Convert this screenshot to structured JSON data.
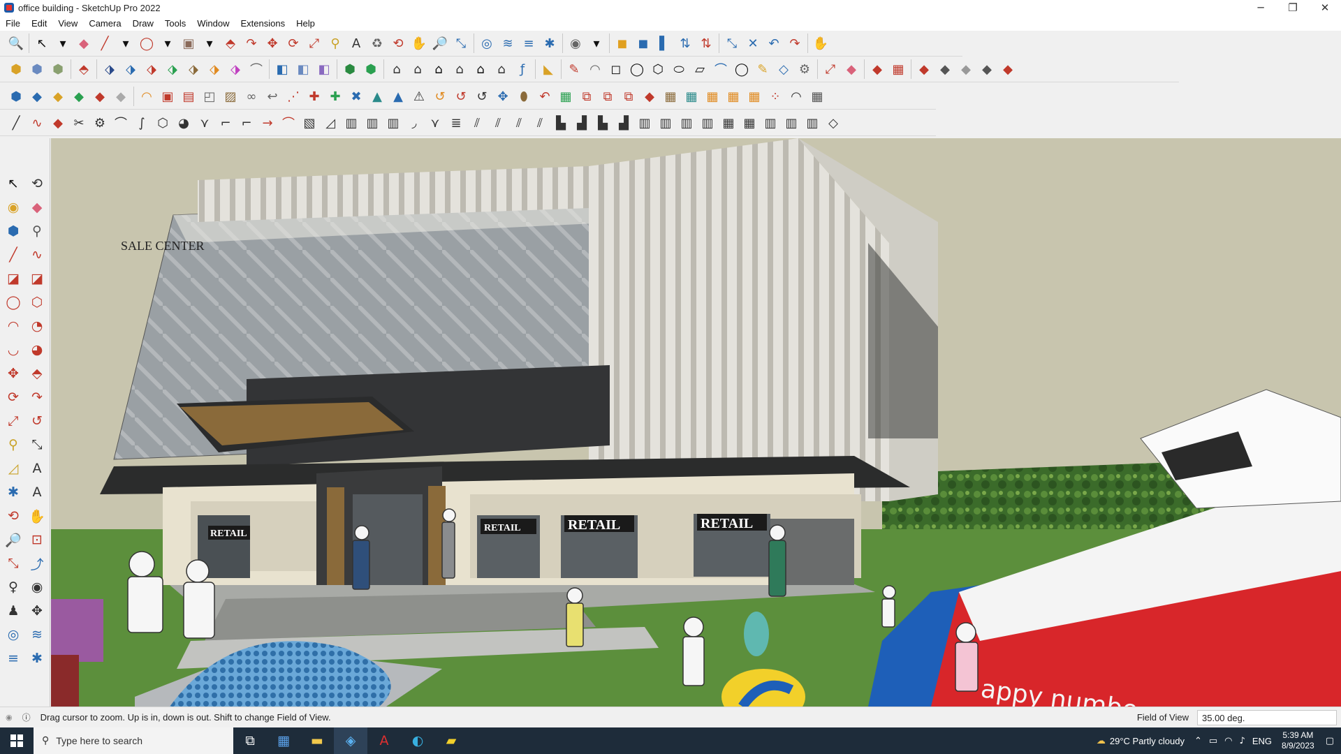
{
  "window": {
    "title": "office building - SketchUp Pro 2022",
    "minimize": "─",
    "maximize": "❐",
    "close": "✕"
  },
  "menu": [
    "File",
    "Edit",
    "View",
    "Camera",
    "Draw",
    "Tools",
    "Window",
    "Extensions",
    "Help"
  ],
  "toolbars": [
    {
      "icons": [
        [
          "zoom-icon",
          "🔍",
          "#222"
        ],
        [
          "sep"
        ],
        [
          "select-icon",
          "↖",
          "#111"
        ],
        [
          "dropdown-arrow-icon",
          "▾",
          "#111"
        ],
        [
          "eraser-icon",
          "◆",
          "#d9627a"
        ],
        [
          "pencil-icon",
          "╱",
          "#c0392b"
        ],
        [
          "dropdown-arrow-icon",
          "▾",
          "#111"
        ],
        [
          "lasso-icon",
          "◯",
          "#c0392b"
        ],
        [
          "dropdown-arrow-icon",
          "▾",
          "#111"
        ],
        [
          "paint-bucket-icon",
          "▣",
          "#8a6a5a"
        ],
        [
          "dropdown-arrow-icon",
          "▾",
          "#111"
        ],
        [
          "push-pull-icon",
          "⬘",
          "#c0392b"
        ],
        [
          "follow-me-icon",
          "↷",
          "#c0392b"
        ],
        [
          "move-icon",
          "✥",
          "#c0392b"
        ],
        [
          "rotate-icon",
          "⟳",
          "#c0392b"
        ],
        [
          "scale-icon",
          "⤢",
          "#c0392b"
        ],
        [
          "tape-measure-icon",
          "⚲",
          "#c9a227"
        ],
        [
          "text-icon",
          "A",
          "#333"
        ],
        [
          "paint-icon",
          "♻",
          "#666"
        ],
        [
          "orbit-icon",
          "⟲",
          "#c0392b"
        ],
        [
          "pan-icon",
          "✋",
          "#d49a3a"
        ],
        [
          "zoom-tool-icon",
          "🔎",
          "#2a6bb0"
        ],
        [
          "zoom-extents-icon",
          "⤡",
          "#2a6bb0"
        ],
        [
          "sep"
        ],
        [
          "warehouse-icon",
          "◎",
          "#2a6bb0"
        ],
        [
          "extension-warehouse-icon",
          "≋",
          "#2a6bb0"
        ],
        [
          "layers-icon",
          "≡",
          "#2a6bb0"
        ],
        [
          "styles-icon",
          "✱",
          "#2a6bb0"
        ],
        [
          "sep"
        ],
        [
          "account-icon",
          "◉",
          "#666"
        ],
        [
          "dropdown-arrow-icon",
          "▾",
          "#111"
        ],
        [
          "sep"
        ],
        [
          "section-plane-icon",
          "◼",
          "#e0a020"
        ],
        [
          "section-display-icon",
          "◼",
          "#2a6bb0"
        ],
        [
          "section-cut-icon",
          "▌",
          "#2a6bb0"
        ],
        [
          "arrange-icon",
          "⇅",
          "#2a6bb0"
        ],
        [
          "flip-icon",
          "⇅",
          "#c0392b"
        ],
        [
          "sep"
        ],
        [
          "dimension-icon",
          "⤡",
          "#2a6bb0"
        ],
        [
          "protractor-icon",
          "✕",
          "#2a6bb0"
        ],
        [
          "undo-icon",
          "↶",
          "#2a6bb0"
        ],
        [
          "redo-icon",
          "↷",
          "#c0392b"
        ],
        [
          "sep"
        ],
        [
          "hand-icon",
          "✋",
          "#c0392b"
        ]
      ]
    },
    {
      "icons": [
        [
          "box-xray-icon",
          "⬢",
          "#d9a227"
        ],
        [
          "box-wire-icon",
          "⬢",
          "#6a8ac0"
        ],
        [
          "box-shaded-icon",
          "⬢",
          "#8aa070"
        ],
        [
          "sep"
        ],
        [
          "push-pull-icon",
          "⬘",
          "#c0392b"
        ],
        [
          "sep"
        ],
        [
          "extrude-icon",
          "⬗",
          "#2a4a8a"
        ],
        [
          "extrude-icon",
          "⬗",
          "#2a6bb0"
        ],
        [
          "extrude-icon",
          "⬗",
          "#c0392b"
        ],
        [
          "extrude-icon",
          "⬗",
          "#2aa050"
        ],
        [
          "extrude-icon",
          "⬗",
          "#8a6a3a"
        ],
        [
          "extrude-icon",
          "⬗",
          "#e08a20"
        ],
        [
          "extrude-icon",
          "⬗",
          "#c040c0"
        ],
        [
          "curve-icon",
          "⌒",
          "#666"
        ],
        [
          "sep"
        ],
        [
          "shape-icon",
          "◧",
          "#2a6bb0"
        ],
        [
          "shape-icon",
          "◧",
          "#6a8ac0"
        ],
        [
          "shape-icon",
          "◧",
          "#8a6ac0"
        ],
        [
          "sep"
        ],
        [
          "component-icon",
          "⬢",
          "#2a8a40"
        ],
        [
          "component-icon",
          "⬢",
          "#2aa050"
        ],
        [
          "sep"
        ],
        [
          "house-icon",
          "⌂",
          "#333"
        ],
        [
          "house-icon",
          "⌂",
          "#333"
        ],
        [
          "house-icon",
          "⌂",
          "#111"
        ],
        [
          "house-icon",
          "⌂",
          "#333"
        ],
        [
          "house-icon",
          "⌂",
          "#111"
        ],
        [
          "house-icon",
          "⌂",
          "#333"
        ],
        [
          "function-icon",
          "ƒ",
          "#2a6bb0"
        ],
        [
          "sep"
        ],
        [
          "tag-icon",
          "◣",
          "#d9a227"
        ],
        [
          "sep"
        ],
        [
          "edit-icon",
          "✎",
          "#c0392b"
        ],
        [
          "arc-icon",
          "◠",
          "#666"
        ],
        [
          "square-icon",
          "◻",
          "#111"
        ],
        [
          "circle-icon",
          "◯",
          "#111"
        ],
        [
          "polygon-icon",
          "⬡",
          "#111"
        ],
        [
          "ellipse-icon",
          "⬭",
          "#111"
        ],
        [
          "parallelogram-icon",
          "▱",
          "#111"
        ],
        [
          "curve-icon",
          "⌒",
          "#2a6bb0"
        ],
        [
          "circle-icon",
          "◯",
          "#111"
        ],
        [
          "edit-icon",
          "✎",
          "#d9a227"
        ],
        [
          "stamp-icon",
          "◇",
          "#2a6bb0"
        ],
        [
          "gear-icon",
          "⚙",
          "#666"
        ],
        [
          "sep"
        ],
        [
          "line-tool-icon",
          "⤢",
          "#c0392b"
        ],
        [
          "eraser-icon",
          "◆",
          "#d9627a"
        ],
        [
          "sep"
        ],
        [
          "stamp-icon",
          "◆",
          "#c0392b"
        ],
        [
          "grid-icon",
          "▦",
          "#c0392b"
        ],
        [
          "sep"
        ],
        [
          "sandbox-icon",
          "◆",
          "#c0392b"
        ],
        [
          "sandbox-icon",
          "◆",
          "#555"
        ],
        [
          "sandbox-icon",
          "◆",
          "#999"
        ],
        [
          "sandbox-icon",
          "◆",
          "#555"
        ],
        [
          "sandbox-icon",
          "◆",
          "#c0392b"
        ]
      ]
    },
    {
      "icons": [
        [
          "cube-icon",
          "⬢",
          "#2a6bb0"
        ],
        [
          "plane-icon",
          "◆",
          "#2a6bb0"
        ],
        [
          "plane-icon",
          "◆",
          "#d9a227"
        ],
        [
          "plane-icon",
          "◆",
          "#2aa050"
        ],
        [
          "plane-icon",
          "◆",
          "#c0392b"
        ],
        [
          "plane-icon",
          "◆",
          "#aaa"
        ],
        [
          "sep"
        ],
        [
          "arc-icon",
          "◠",
          "#e08a20"
        ],
        [
          "rect-icon",
          "▣",
          "#c0392b"
        ],
        [
          "table-icon",
          "▤",
          "#c0392b"
        ],
        [
          "frame-icon",
          "◰",
          "#666"
        ],
        [
          "box-icon",
          "▨",
          "#8a6a3a"
        ],
        [
          "link-icon",
          "∞",
          "#666"
        ],
        [
          "bend-icon",
          "↩",
          "#666"
        ],
        [
          "dotted-icon",
          "⋰",
          "#c0392b"
        ],
        [
          "cross-icon",
          "✚",
          "#c0392b"
        ],
        [
          "cross-icon",
          "✚",
          "#2aa050"
        ],
        [
          "scissors-icon",
          "✖",
          "#2a6bb0"
        ],
        [
          "cone-icon",
          "▲",
          "#2a8a8a"
        ],
        [
          "cone-icon",
          "▲",
          "#2a6bb0"
        ],
        [
          "warning-icon",
          "⚠",
          "#333"
        ],
        [
          "spiral-icon",
          "↺",
          "#e08a20"
        ],
        [
          "spiral-icon",
          "↺",
          "#c0392b"
        ],
        [
          "spiral-icon",
          "↺",
          "#333"
        ],
        [
          "move-icon",
          "✥",
          "#2a6bb0"
        ],
        [
          "cylinder-icon",
          "⬮",
          "#8a6a3a"
        ],
        [
          "loop-icon",
          "↶",
          "#c0392b"
        ],
        [
          "grid-icon",
          "▦",
          "#2aa050"
        ],
        [
          "array-icon",
          "⧉",
          "#c0392b"
        ],
        [
          "array-icon",
          "⧉",
          "#c0392b"
        ],
        [
          "array-icon",
          "⧉",
          "#c0392b"
        ],
        [
          "label-icon",
          "◆",
          "#c0392b"
        ],
        [
          "grid-icon",
          "▦",
          "#8a6a3a"
        ],
        [
          "grid-icon",
          "▦",
          "#2a8a8a"
        ],
        [
          "grid-icon",
          "▦",
          "#e08a20"
        ],
        [
          "grid-icon",
          "▦",
          "#e08a20"
        ],
        [
          "grid-icon",
          "▦",
          "#e08a20"
        ],
        [
          "scatter-icon",
          "⁘",
          "#c0392b"
        ],
        [
          "arc-icon",
          "◠",
          "#333"
        ],
        [
          "grid-icon",
          "▦",
          "#555"
        ]
      ]
    },
    {
      "icons": [
        [
          "line-icon",
          "╱",
          "#333"
        ],
        [
          "bezier-icon",
          "∿",
          "#c0392b"
        ],
        [
          "car-icon",
          "◆",
          "#c0392b"
        ],
        [
          "scissors-icon",
          "✂",
          "#333"
        ],
        [
          "gear-icon",
          "⚙",
          "#333"
        ],
        [
          "link-icon",
          "⌒",
          "#333"
        ],
        [
          "pipe-icon",
          "∫",
          "#333"
        ],
        [
          "cube-outline-icon",
          "⬡",
          "#333"
        ],
        [
          "sphere-icon",
          "◕",
          "#333"
        ],
        [
          "fold-icon",
          "⋎",
          "#333"
        ],
        [
          "path-icon",
          "⌐",
          "#333"
        ],
        [
          "path-icon",
          "⌐",
          "#333"
        ],
        [
          "arrow-line-icon",
          "→",
          "#c0392b"
        ],
        [
          "curve-icon",
          "⌒",
          "#c0392b"
        ],
        [
          "box-icon",
          "▧",
          "#333"
        ],
        [
          "wedge-icon",
          "◿",
          "#333"
        ],
        [
          "bars-icon",
          "▥",
          "#333"
        ],
        [
          "bars-icon",
          "▥",
          "#333"
        ],
        [
          "bars-icon",
          "▥",
          "#333"
        ],
        [
          "curtain-icon",
          "◞",
          "#333"
        ],
        [
          "fold-icon",
          "⋎",
          "#333"
        ],
        [
          "stack-icon",
          "≣",
          "#333"
        ],
        [
          "slash-icon",
          "⫽",
          "#333"
        ],
        [
          "slash-icon",
          "⫽",
          "#333"
        ],
        [
          "slash-icon",
          "⫽",
          "#333"
        ],
        [
          "slash-icon",
          "⫽",
          "#333"
        ],
        [
          "stair-icon",
          "▙",
          "#333"
        ],
        [
          "stair-icon",
          "▟",
          "#333"
        ],
        [
          "stair-icon",
          "▙",
          "#333"
        ],
        [
          "stair-icon",
          "▟",
          "#333"
        ],
        [
          "bars-icon",
          "▥",
          "#333"
        ],
        [
          "bars-icon",
          "▥",
          "#333"
        ],
        [
          "bars-icon",
          "▥",
          "#333"
        ],
        [
          "bars-icon",
          "▥",
          "#333"
        ],
        [
          "grid-icon",
          "▦",
          "#333"
        ],
        [
          "grid-icon",
          "▦",
          "#333"
        ],
        [
          "bars-icon",
          "▥",
          "#333"
        ],
        [
          "bars-icon",
          "▥",
          "#333"
        ],
        [
          "bars-icon",
          "▥",
          "#333"
        ],
        [
          "shape-icon",
          "◇",
          "#333"
        ]
      ]
    }
  ],
  "left_tools": [
    [
      "select-icon",
      "↖",
      "#111"
    ],
    [
      "orbit-icon",
      "⟲",
      "#333"
    ],
    [
      "paint-icon",
      "◉",
      "#d9a227"
    ],
    [
      "eraser-icon",
      "◆",
      "#d9627a"
    ],
    [
      "component-icon",
      "⬢",
      "#2a6bb0"
    ],
    [
      "tape-icon",
      "⚲",
      "#555"
    ],
    [
      "pencil-icon",
      "╱",
      "#c0392b"
    ],
    [
      "freehand-icon",
      "∿",
      "#c0392b"
    ],
    [
      "rectangle-icon",
      "◪",
      "#c0392b"
    ],
    [
      "rotated-rect-icon",
      "◪",
      "#c0392b"
    ],
    [
      "circle-icon",
      "◯",
      "#c0392b"
    ],
    [
      "polygon-icon",
      "⬡",
      "#c0392b"
    ],
    [
      "arc-icon",
      "◠",
      "#c0392b"
    ],
    [
      "pie-icon",
      "◔",
      "#c0392b"
    ],
    [
      "arc3-icon",
      "◡",
      "#c0392b"
    ],
    [
      "pie2-icon",
      "◕",
      "#c0392b"
    ],
    [
      "move-icon",
      "✥",
      "#c0392b"
    ],
    [
      "push-pull-icon",
      "⬘",
      "#c0392b"
    ],
    [
      "rotate-icon",
      "⟳",
      "#c0392b"
    ],
    [
      "follow-me-icon",
      "↷",
      "#c0392b"
    ],
    [
      "scale-icon",
      "⤢",
      "#c0392b"
    ],
    [
      "offset-icon",
      "↺",
      "#c0392b"
    ],
    [
      "tape-measure-icon",
      "⚲",
      "#c9a227"
    ],
    [
      "dimension-icon",
      "⤡",
      "#333"
    ],
    [
      "protractor-icon",
      "◿",
      "#c9a227"
    ],
    [
      "text-icon",
      "A",
      "#333"
    ],
    [
      "axes-icon",
      "✱",
      "#2a6bb0"
    ],
    [
      "3d-text-icon",
      "A",
      "#333"
    ],
    [
      "orbit-icon",
      "⟲",
      "#c0392b"
    ],
    [
      "pan-icon",
      "✋",
      "#d49a3a"
    ],
    [
      "zoom-icon",
      "🔎",
      "#2a6bb0"
    ],
    [
      "zoom-window-icon",
      "⊡",
      "#c0392b"
    ],
    [
      "zoom-extents-icon",
      "⤡",
      "#c0392b"
    ],
    [
      "previous-icon",
      "⤴",
      "#2a6bb0"
    ],
    [
      "position-camera-icon",
      "♀",
      "#333"
    ],
    [
      "look-around-icon",
      "◉",
      "#333"
    ],
    [
      "walk-icon",
      "♟",
      "#333"
    ],
    [
      "section-plane-icon",
      "✥",
      "#333"
    ],
    [
      "warehouse-icon",
      "◎",
      "#2a6bb0"
    ],
    [
      "extension-icon",
      "≋",
      "#2a6bb0"
    ],
    [
      "layers-icon",
      "≡",
      "#2a6bb0"
    ],
    [
      "styles-icon",
      "✱",
      "#2a6bb0"
    ]
  ],
  "viewport": {
    "sign_sale_center": "SALE CENTER",
    "retail_sign": "RETAIL",
    "boat_text": "appy numbe"
  },
  "status": {
    "message": "Drag cursor to zoom.  Up is in, down is out. Shift to change Field of View.",
    "fov_label": "Field of View",
    "fov_value": "35.00 deg."
  },
  "taskbar": {
    "search_placeholder": "Type here to search",
    "weather": "29°C  Partly cloudy",
    "lang": "ENG",
    "time": "5:39 AM",
    "date": "8/9/2023"
  }
}
